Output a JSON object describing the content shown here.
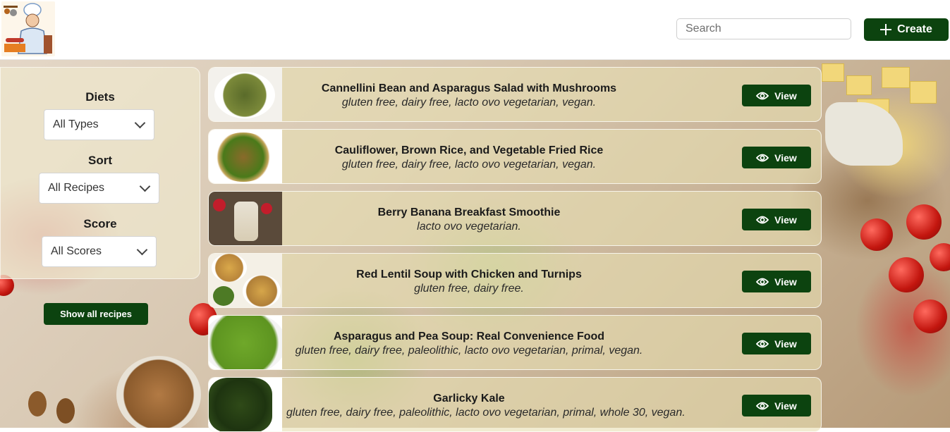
{
  "header": {
    "search_placeholder": "Search",
    "create_label": "Create"
  },
  "sidebar": {
    "diets_label": "Diets",
    "diets_value": "All Types",
    "sort_label": "Sort",
    "sort_value": "All Recipes",
    "score_label": "Score",
    "score_value": "All Scores",
    "show_all_label": "Show all recipes"
  },
  "recipes": [
    {
      "title": "Cannellini Bean and Asparagus Salad with Mushrooms",
      "diets": "gluten free, dairy free, lacto ovo vegetarian, vegan.",
      "view_label": "View"
    },
    {
      "title": "Cauliflower, Brown Rice, and Vegetable Fried Rice",
      "diets": "gluten free, dairy free, lacto ovo vegetarian, vegan.",
      "view_label": "View"
    },
    {
      "title": "Berry Banana Breakfast Smoothie",
      "diets": "lacto ovo vegetarian.",
      "view_label": "View"
    },
    {
      "title": "Red Lentil Soup with Chicken and Turnips",
      "diets": "gluten free, dairy free.",
      "view_label": "View"
    },
    {
      "title": "Asparagus and Pea Soup: Real Convenience Food",
      "diets": "gluten free, dairy free, paleolithic, lacto ovo vegetarian, primal, vegan.",
      "view_label": "View"
    },
    {
      "title": "Garlicky Kale",
      "diets": "gluten free, dairy free, paleolithic, lacto ovo vegetarian, primal, whole 30, vegan.",
      "view_label": "View"
    }
  ],
  "colors": {
    "brand_green": "#0c430f"
  },
  "icons": {
    "logo": "chef-logo-icon",
    "create": "plus-icon",
    "view": "eye-icon",
    "dropdown": "chevron-down-icon"
  }
}
